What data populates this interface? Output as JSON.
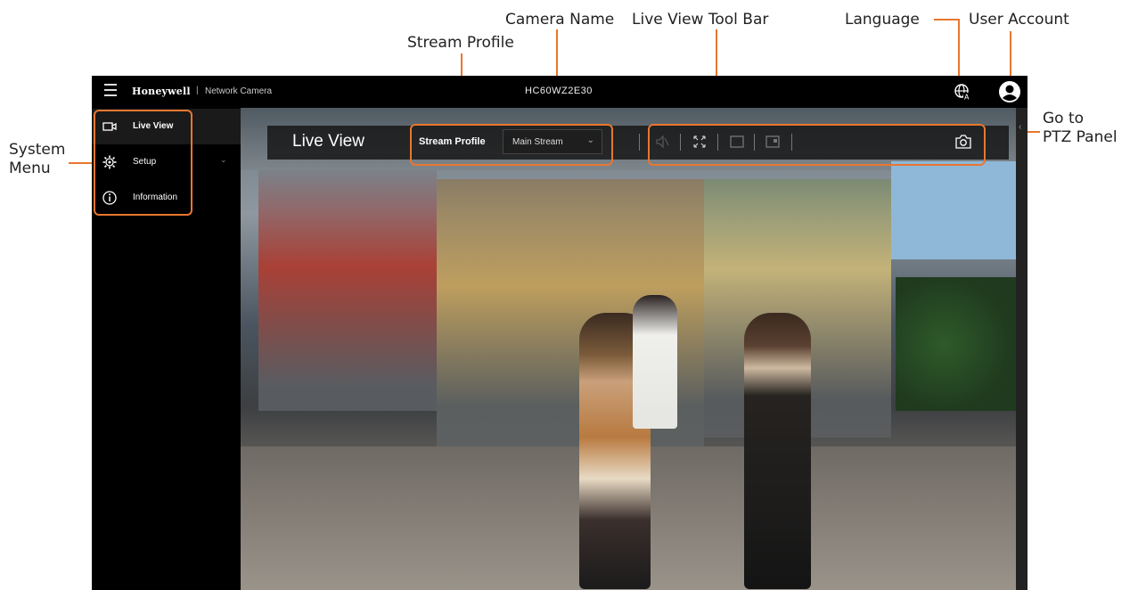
{
  "annotations": {
    "camera_name": "Camera Name",
    "live_view_tool_bar": "Live View Tool Bar",
    "language": "Language",
    "user_account": "User Account",
    "stream_profile": "Stream Profile",
    "system_menu": "System\nMenu",
    "ptz_panel": "Go to\nPTZ Panel"
  },
  "header": {
    "brand": "Honeywell",
    "separator": "|",
    "product": "Network Camera",
    "camera_name": "HC60WZ2E30",
    "icons": [
      "menu-icon",
      "language-icon",
      "user-account-icon"
    ]
  },
  "sidebar": {
    "items": [
      {
        "label": "Live View",
        "icon": "video-camera-icon",
        "active": true
      },
      {
        "label": "Setup",
        "icon": "gear-icon",
        "active": false
      },
      {
        "label": "Information",
        "icon": "info-icon",
        "active": false
      }
    ]
  },
  "toolbar": {
    "title": "Live View",
    "stream_profile_label": "Stream Profile",
    "stream_profile_value": "Main Stream",
    "icons": [
      "audio-icon",
      "fullscreen-icon",
      "window-icon",
      "pip-icon",
      "snapshot-icon"
    ]
  },
  "colors": {
    "annotation": "#e8772e",
    "background": "#000000"
  }
}
